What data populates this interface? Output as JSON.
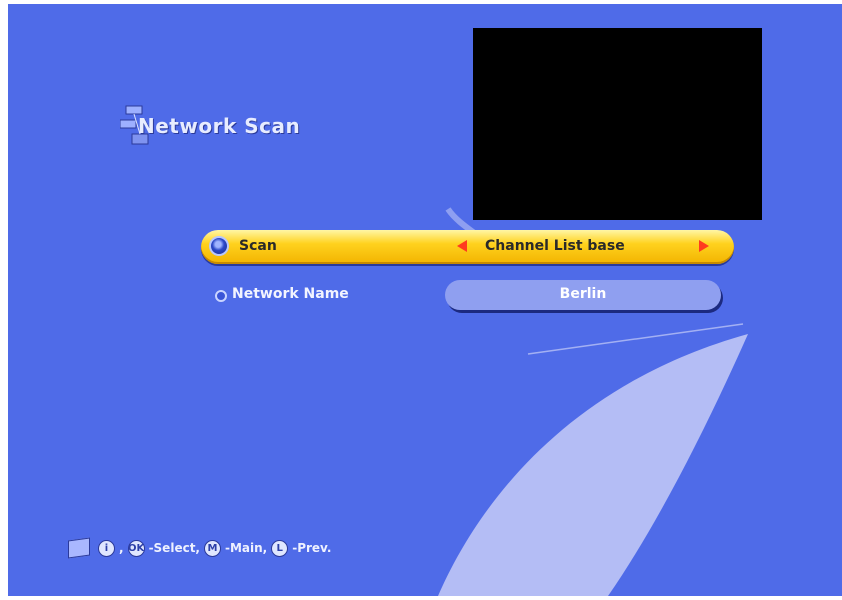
{
  "screen": {
    "title": "Network Scan",
    "background_color": "#4f6be8",
    "preview_color": "#000000"
  },
  "menu": {
    "scan": {
      "label": "Scan",
      "value": "Channel List base",
      "highlight_color": "#ffd21e",
      "arrow_color": "#ff3b1f"
    },
    "network_name": {
      "label": "Network Name",
      "value": "Berlin"
    }
  },
  "help": {
    "icon": "manual-book-icon",
    "key_i": "i",
    "sep1": ",",
    "key_ok": "OK",
    "select_text": "-Select,",
    "key_m": "M",
    "main_text": "-Main,",
    "key_l": "L",
    "prev_text": "-Prev."
  }
}
